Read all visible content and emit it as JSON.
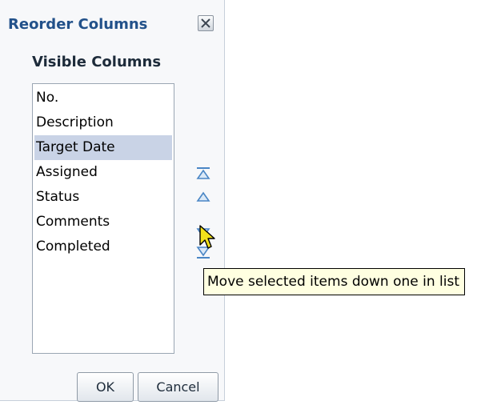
{
  "dialog": {
    "title": "Reorder Columns",
    "close_icon": "close-icon",
    "section_label": "Visible Columns",
    "list_items": [
      "No.",
      "Description",
      "Target Date",
      "Assigned",
      "Status",
      "Comments",
      "Completed"
    ],
    "selected_index": 2,
    "move_buttons": [
      {
        "name": "move-to-top-button",
        "icon": "move-to-top-icon"
      },
      {
        "name": "move-up-button",
        "icon": "move-up-icon"
      },
      {
        "name": "move-down-button",
        "icon": "move-down-icon"
      },
      {
        "name": "move-to-bottom-button",
        "icon": "move-to-bottom-icon"
      }
    ],
    "tooltip": "Move selected items down one in list",
    "ok_label": "OK",
    "cancel_label": "Cancel"
  },
  "colors": {
    "title": "#22518a",
    "selection": "#c9d3e6",
    "icon": "#4a86c5",
    "tooltip_background": "#ffffe1"
  }
}
